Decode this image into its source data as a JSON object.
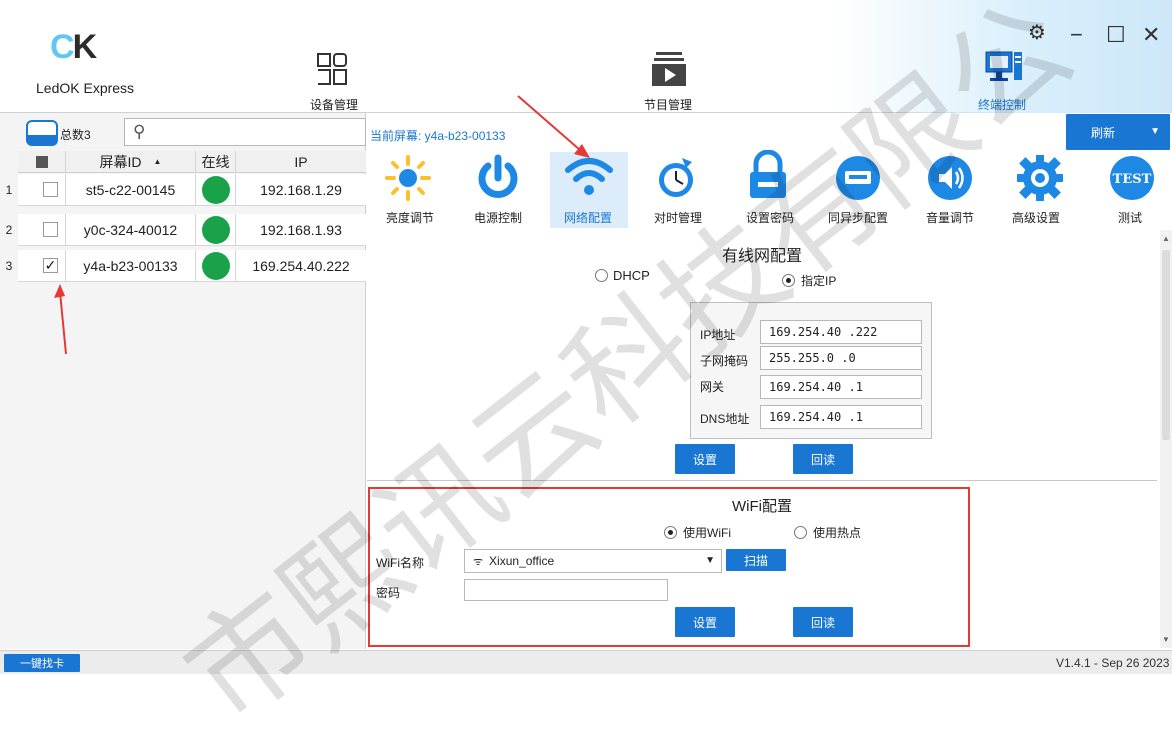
{
  "app": {
    "name": "LedOK Express",
    "version": "V1.4.1 - Sep 26 2023"
  },
  "nav": {
    "device_mgmt": "设备管理",
    "program_mgmt": "节目管理",
    "terminal_ctrl": "终端控制"
  },
  "left": {
    "total_label": "总数3",
    "columns": [
      "屏幕ID",
      "在线",
      "IP"
    ],
    "rows": [
      {
        "num": "1",
        "checked": "",
        "id": "st5-c22-00145",
        "ip": "192.168.1.29"
      },
      {
        "num": "2",
        "checked": "",
        "id": "y0c-324-40012",
        "ip": "192.168.1.93"
      },
      {
        "num": "3",
        "checked": "✓",
        "id": "y4a-b23-00133",
        "ip": "169.254.40.222"
      }
    ]
  },
  "current_screen": "当前屏幕: y4a-b23-00133",
  "refresh": "刷新",
  "tools": [
    "亮度调节",
    "电源控制",
    "网络配置",
    "对时管理",
    "设置密码",
    "同异步配置",
    "音量调节",
    "高级设置",
    "测试"
  ],
  "wired": {
    "title": "有线网配置",
    "dhcp": "DHCP",
    "static": "指定IP",
    "ip_label": "IP地址",
    "ip_value": "169.254.40 .222",
    "mask_label": "子网掩码",
    "mask_value": "255.255.0  .0",
    "gw_label": "网关",
    "gw_value": "169.254.40 .1",
    "dns_label": "DNS地址",
    "dns_value": "169.254.40 .1",
    "set": "设置",
    "readback": "回读"
  },
  "wifi": {
    "title": "WiFi配置",
    "use_wifi": "使用WiFi",
    "use_hotspot": "使用热点",
    "name_label": "WiFi名称",
    "name_value": "Xixun_office",
    "scan": "扫描",
    "pwd_label": "密码",
    "pwd_value": "",
    "set": "设置",
    "readback": "回读"
  },
  "status": {
    "find_card": "一键找卡"
  },
  "colors": {
    "accent": "#1976d2",
    "online": "#1aa24a",
    "highlight": "#e53935"
  },
  "watermark": "市熙讯云科技有限公"
}
